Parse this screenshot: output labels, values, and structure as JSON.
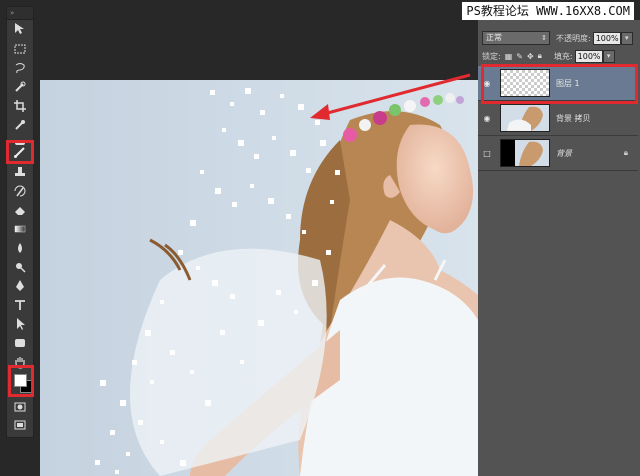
{
  "watermark": "PS教程论坛 WWW.16XX8.COM",
  "toolbox": {
    "grip": "»",
    "tools": [
      "move-tool",
      "marquee-tool",
      "lasso-tool",
      "quick-select-tool",
      "crop-tool",
      "eyedropper-tool",
      "healing-tool",
      "brush-tool",
      "clone-stamp-tool",
      "history-brush-tool",
      "eraser-tool",
      "gradient-tool",
      "blur-tool",
      "dodge-tool",
      "pen-tool",
      "type-tool",
      "path-select-tool",
      "shape-tool",
      "hand-tool",
      "zoom-tool"
    ],
    "highlighted_tool": "brush-tool",
    "foreground_color": "#ffffff",
    "background_color": "#000000"
  },
  "layers_panel": {
    "blend_mode": "正常",
    "opacity_label": "不透明度:",
    "opacity_value": "100%",
    "lock_label": "锁定:",
    "fill_label": "填充:",
    "fill_value": "100%",
    "layers": [
      {
        "name": "图层 1",
        "visible": true,
        "selected": true,
        "thumb": "transparent"
      },
      {
        "name": "背景 拷贝",
        "visible": true,
        "selected": false,
        "thumb": "photo"
      },
      {
        "name": "背景",
        "visible": false,
        "selected": false,
        "thumb": "photo-black",
        "locked": true
      }
    ]
  },
  "colors": {
    "highlight": "#e02a30",
    "selected_layer": "#6a7a92",
    "panel": "#535353"
  }
}
